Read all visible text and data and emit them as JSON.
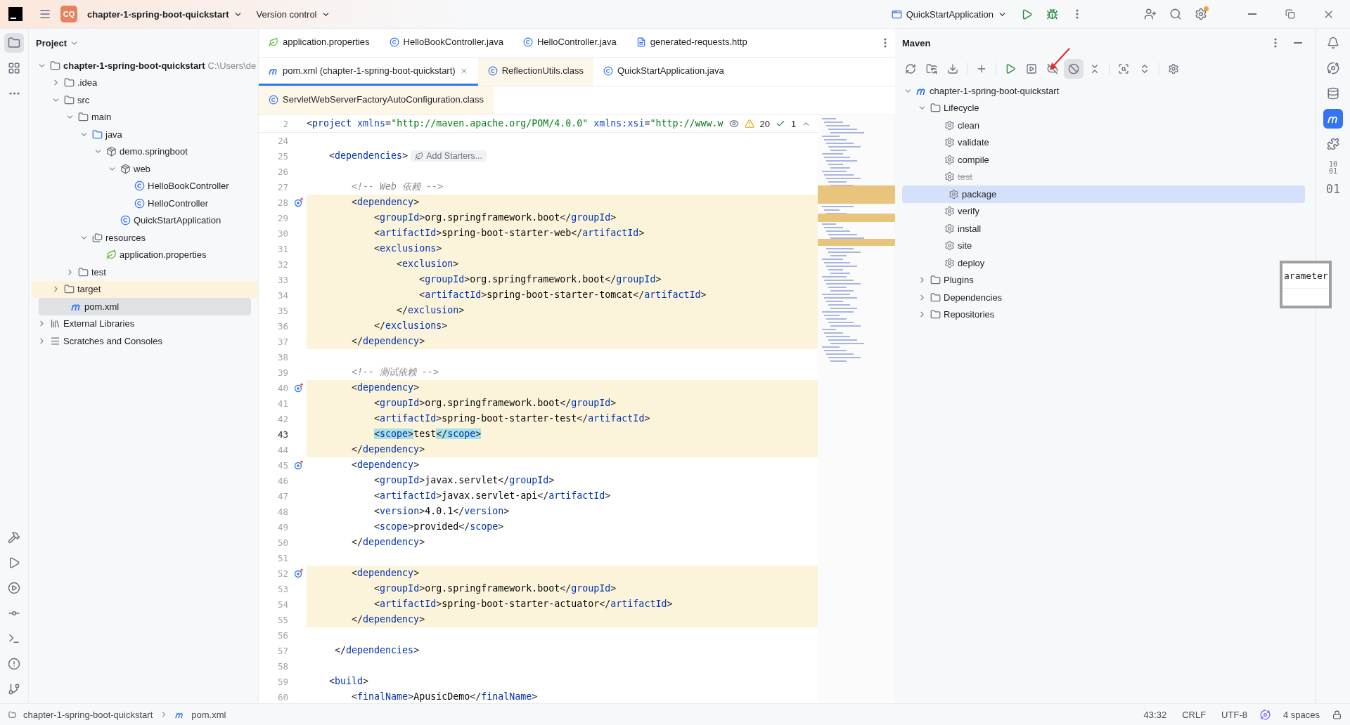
{
  "title_bar": {
    "project_badge": "CQ",
    "project": "chapter-1-spring-boot-quickstart",
    "vcs": "Version control",
    "run_config": "QuickStartApplication",
    "settings_notice": true
  },
  "left_tools": {
    "top": [
      {
        "kind": "project",
        "selected": true
      },
      {
        "kind": "structure",
        "selected": false
      },
      {
        "kind": "more",
        "selected": false
      }
    ],
    "bottom": [
      {
        "kind": "build"
      },
      {
        "kind": "run"
      },
      {
        "kind": "services"
      },
      {
        "kind": "commit"
      },
      {
        "kind": "terminal"
      },
      {
        "kind": "problems"
      },
      {
        "kind": "git"
      }
    ]
  },
  "project_panel": {
    "title": "Project",
    "tree": [
      {
        "label": "chapter-1-spring-boot-quickstart",
        "hint": "C:\\Users\\de",
        "kind": "module",
        "expanded": true,
        "selected": false,
        "excluded": false,
        "children": [
          {
            "label": ".idea",
            "kind": "folder",
            "expanded": false,
            "selected": false,
            "excluded": false
          },
          {
            "label": "src",
            "kind": "folder",
            "expanded": true,
            "selected": false,
            "excluded": false,
            "children": [
              {
                "label": "main",
                "kind": "folder",
                "expanded": true,
                "selected": false,
                "excluded": false,
                "children": [
                  {
                    "label": "java",
                    "kind": "source",
                    "expanded": true,
                    "selected": false,
                    "excluded": false,
                    "children": [
                      {
                        "label": "demo.springboot",
                        "kind": "package",
                        "expanded": true,
                        "selected": false,
                        "excluded": false,
                        "children": [
                          {
                            "label": "web",
                            "kind": "package",
                            "expanded": true,
                            "selected": false,
                            "excluded": false,
                            "children": [
                              {
                                "label": "HelloBookController",
                                "kind": "class",
                                "selected": false,
                                "excluded": false
                              },
                              {
                                "label": "HelloController",
                                "kind": "class",
                                "selected": false,
                                "excluded": false
                              }
                            ]
                          },
                          {
                            "label": "QuickStartApplication",
                            "kind": "app",
                            "selected": false,
                            "excluded": false
                          }
                        ]
                      }
                    ]
                  },
                  {
                    "label": "resources",
                    "kind": "resources",
                    "expanded": true,
                    "selected": false,
                    "excluded": false,
                    "children": [
                      {
                        "label": "application.properties",
                        "kind": "properties",
                        "selected": false,
                        "excluded": false
                      }
                    ]
                  }
                ]
              },
              {
                "label": "test",
                "kind": "folder",
                "expanded": false,
                "selected": false,
                "excluded": false
              }
            ]
          },
          {
            "label": "target",
            "kind": "folder",
            "expanded": false,
            "selected": false,
            "excluded": true
          },
          {
            "label": "pom.xml",
            "kind": "maven",
            "selected": true,
            "excluded": false
          }
        ]
      },
      {
        "label": "External Libraries",
        "kind": "library",
        "expanded": false,
        "selected": false,
        "excluded": false
      },
      {
        "label": "Scratches and Consoles",
        "kind": "scratches",
        "expanded": false,
        "selected": false,
        "excluded": false
      }
    ]
  },
  "editor_tabs": [
    [
      {
        "label": "application.properties",
        "kind": "properties",
        "selected": false,
        "readonly": false
      },
      {
        "label": "HelloBookController.java",
        "kind": "class",
        "selected": false,
        "readonly": false
      },
      {
        "label": "HelloController.java",
        "kind": "class",
        "selected": false,
        "readonly": false
      },
      {
        "label": "generated-requests.http",
        "kind": "http",
        "selected": false,
        "readonly": false
      }
    ],
    [
      {
        "label": "pom.xml (chapter-1-spring-boot-quickstart)",
        "kind": "maven",
        "selected": true,
        "readonly": false
      },
      {
        "label": "ReflectionUtils.class",
        "kind": "class",
        "selected": false,
        "readonly": true
      },
      {
        "label": "QuickStartApplication.java",
        "kind": "app",
        "selected": false,
        "readonly": false
      }
    ],
    [
      {
        "label": "ServletWebServerFactoryAutoConfiguration.class",
        "kind": "class",
        "selected": false,
        "readonly": true
      }
    ]
  ],
  "editor": {
    "sticky_line": {
      "number": "2",
      "text": "<project xmlns=\"http://maven.apache.org/POM/4.0.0\" xmlns:xsi=\"http://www.w"
    },
    "warnings": "20",
    "passed": "1",
    "lines": [
      {
        "number": "24",
        "changed": false,
        "current": false,
        "gutter_mark": false
      },
      {
        "number": "25",
        "text": "    <dependencies>",
        "inlay": "Add Starters...",
        "changed": false,
        "current": false,
        "gutter_mark": false
      },
      {
        "number": "26",
        "changed": false,
        "current": false,
        "gutter_mark": false
      },
      {
        "number": "27",
        "text": "        <!-- Web 依赖 -->",
        "changed": false,
        "current": false,
        "gutter_mark": false
      },
      {
        "number": "28",
        "text": "        <dependency>",
        "changed": true,
        "current": false,
        "gutter_mark": true
      },
      {
        "number": "29",
        "text": "            <groupId>org.springframework.boot</groupId>",
        "changed": true,
        "current": false,
        "gutter_mark": false
      },
      {
        "number": "30",
        "text": "            <artifactId>spring-boot-starter-web</artifactId>",
        "changed": true,
        "current": false,
        "gutter_mark": false
      },
      {
        "number": "31",
        "text": "            <exclusions>",
        "changed": true,
        "current": false,
        "gutter_mark": false
      },
      {
        "number": "32",
        "text": "                <exclusion>",
        "changed": true,
        "current": false,
        "gutter_mark": false
      },
      {
        "number": "33",
        "text": "                    <groupId>org.springframework.boot</groupId>",
        "changed": true,
        "current": false,
        "gutter_mark": false
      },
      {
        "number": "34",
        "text": "                    <artifactId>spring-boot-starter-tomcat</artifactId>",
        "changed": true,
        "current": false,
        "gutter_mark": false
      },
      {
        "number": "35",
        "text": "                </exclusion>",
        "changed": true,
        "current": false,
        "gutter_mark": false
      },
      {
        "number": "36",
        "text": "            </exclusions>",
        "changed": true,
        "current": false,
        "gutter_mark": false
      },
      {
        "number": "37",
        "text": "        </dependency>",
        "changed": true,
        "current": false,
        "gutter_mark": false
      },
      {
        "number": "38",
        "changed": false,
        "current": false,
        "gutter_mark": false
      },
      {
        "number": "39",
        "text": "        <!-- 测试依赖 -->",
        "changed": false,
        "current": false,
        "gutter_mark": false
      },
      {
        "number": "40",
        "text": "        <dependency>",
        "changed": true,
        "current": false,
        "gutter_mark": true
      },
      {
        "number": "41",
        "text": "            <groupId>org.springframework.boot</groupId>",
        "changed": true,
        "current": false,
        "gutter_mark": false
      },
      {
        "number": "42",
        "text": "            <artifactId>spring-boot-starter-test</artifactId>",
        "changed": true,
        "current": false,
        "gutter_mark": false
      },
      {
        "number": "43",
        "text": "            <scope>test</scope>",
        "changed": true,
        "current": true,
        "gutter_mark": false,
        "tag_match": true
      },
      {
        "number": "44",
        "text": "        </dependency>",
        "changed": true,
        "current": false,
        "gutter_mark": false
      },
      {
        "number": "45",
        "text": "        <dependency>",
        "changed": false,
        "current": false,
        "gutter_mark": true
      },
      {
        "number": "46",
        "text": "            <groupId>javax.servlet</groupId>",
        "changed": false,
        "current": false,
        "gutter_mark": false
      },
      {
        "number": "47",
        "text": "            <artifactId>javax.servlet-api</artifactId>",
        "changed": false,
        "current": false,
        "gutter_mark": false
      },
      {
        "number": "48",
        "text": "            <version>4.0.1</version>",
        "changed": false,
        "current": false,
        "gutter_mark": false
      },
      {
        "number": "49",
        "text": "            <scope>provided</scope>",
        "changed": false,
        "current": false,
        "gutter_mark": false
      },
      {
        "number": "50",
        "text": "        </dependency>",
        "changed": false,
        "current": false,
        "gutter_mark": false
      },
      {
        "number": "51",
        "changed": false,
        "current": false,
        "gutter_mark": false
      },
      {
        "number": "52",
        "text": "        <dependency>",
        "changed": true,
        "current": false,
        "gutter_mark": true
      },
      {
        "number": "53",
        "text": "            <groupId>org.springframework.boot</groupId>",
        "changed": true,
        "current": false,
        "gutter_mark": false
      },
      {
        "number": "54",
        "text": "            <artifactId>spring-boot-starter-actuator</artifactId>",
        "changed": true,
        "current": false,
        "gutter_mark": false
      },
      {
        "number": "55",
        "text": "        </dependency>",
        "changed": true,
        "current": false,
        "gutter_mark": false
      },
      {
        "number": "56",
        "changed": false,
        "current": false,
        "gutter_mark": false
      },
      {
        "number": "57",
        "text": "     </dependencies>",
        "changed": false,
        "current": false,
        "gutter_mark": false
      },
      {
        "number": "58",
        "changed": false,
        "current": false,
        "gutter_mark": false
      },
      {
        "number": "59",
        "text": "    <build>",
        "changed": false,
        "current": false,
        "gutter_mark": false
      },
      {
        "number": "60",
        "text": "        <finalName>ApusicDemo</finalName>",
        "changed": false,
        "current": false,
        "gutter_mark": false
      }
    ]
  },
  "maven": {
    "title": "Maven",
    "toolbar": [
      {
        "kind": "reload",
        "selected": false
      },
      {
        "kind": "add-folder",
        "selected": false
      },
      {
        "kind": "download",
        "selected": false
      },
      {
        "kind": "plus",
        "selected": false
      },
      {
        "kind": "run",
        "selected": false
      },
      {
        "kind": "execute",
        "selected": false
      },
      {
        "kind": "offline",
        "selected": false
      },
      {
        "kind": "skip",
        "selected": true
      },
      {
        "kind": "collapse",
        "selected": false
      },
      {
        "kind": "analyze",
        "selected": false
      },
      {
        "kind": "expand",
        "selected": false
      },
      {
        "kind": "settings",
        "selected": false
      }
    ],
    "tree": [
      {
        "label": "chapter-1-spring-boot-quickstart",
        "kind": "maven",
        "expanded": true,
        "selected": false,
        "disabled": false,
        "children": [
          {
            "label": "Lifecycle",
            "kind": "folder",
            "expanded": true,
            "selected": false,
            "disabled": false,
            "children": [
              {
                "label": "clean",
                "kind": "goal",
                "selected": false,
                "disabled": false
              },
              {
                "label": "validate",
                "kind": "goal",
                "selected": false,
                "disabled": false
              },
              {
                "label": "compile",
                "kind": "goal",
                "selected": false,
                "disabled": false
              },
              {
                "label": "test",
                "kind": "goal",
                "selected": false,
                "disabled": true
              },
              {
                "label": "package",
                "kind": "goal",
                "selected": true,
                "disabled": false
              },
              {
                "label": "verify",
                "kind": "goal",
                "selected": false,
                "disabled": false
              },
              {
                "label": "install",
                "kind": "goal",
                "selected": false,
                "disabled": false
              },
              {
                "label": "site",
                "kind": "goal",
                "selected": false,
                "disabled": false
              },
              {
                "label": "deploy",
                "kind": "goal",
                "selected": false,
                "disabled": false
              }
            ]
          },
          {
            "label": "Plugins",
            "kind": "folder",
            "expanded": false,
            "selected": false,
            "disabled": false
          },
          {
            "label": "Dependencies",
            "kind": "folder",
            "expanded": false,
            "selected": false,
            "disabled": false
          },
          {
            "label": "Repositories",
            "kind": "folder",
            "expanded": false,
            "selected": false,
            "disabled": false
          }
        ]
      }
    ]
  },
  "right_tools": [
    {
      "kind": "notifications",
      "selected": false
    },
    {
      "kind": "ai",
      "selected": false
    },
    {
      "kind": "database",
      "selected": false
    },
    {
      "kind": "maven",
      "selected": true
    },
    {
      "kind": "plugin",
      "selected": false
    },
    {
      "kind": "binary",
      "label": "10\n01",
      "selected": false
    },
    {
      "kind": "binary",
      "label": "01",
      "selected": false
    }
  ],
  "floating_preview": "arameter",
  "status_bar": {
    "crumbs": [
      {
        "label": "chapter-1-spring-boot-quickstart",
        "kind": "module"
      },
      {
        "label": "pom.xml",
        "kind": "maven"
      }
    ],
    "position": "43:32",
    "line_separator": "CRLF",
    "encoding": "UTF-8",
    "indent": "4 spaces"
  }
}
